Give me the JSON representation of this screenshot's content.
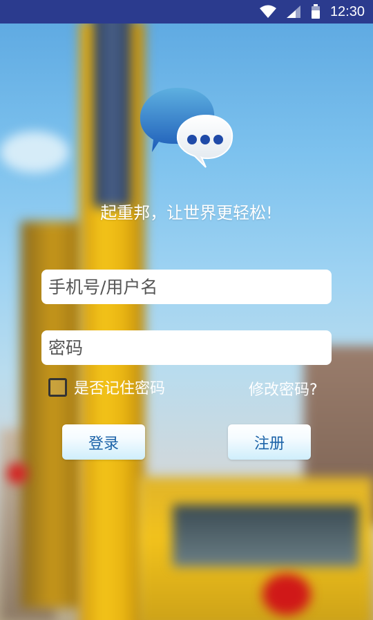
{
  "status_bar": {
    "time": "12:30",
    "icons": [
      "wifi-icon",
      "signal-icon",
      "battery-icon"
    ],
    "background": "#2b3b8e"
  },
  "app": {
    "logo_icon": "chat-bubbles-icon",
    "slogan": "起重邦，让世界更轻松!"
  },
  "login_form": {
    "username_placeholder": "手机号/用户名",
    "password_placeholder": "密码",
    "remember_label": "是否记住密码",
    "remember_checked": false,
    "change_password_link": "修改密码?",
    "login_button": "登录",
    "register_button": "注册",
    "button_text_color": "#1c63a8"
  }
}
